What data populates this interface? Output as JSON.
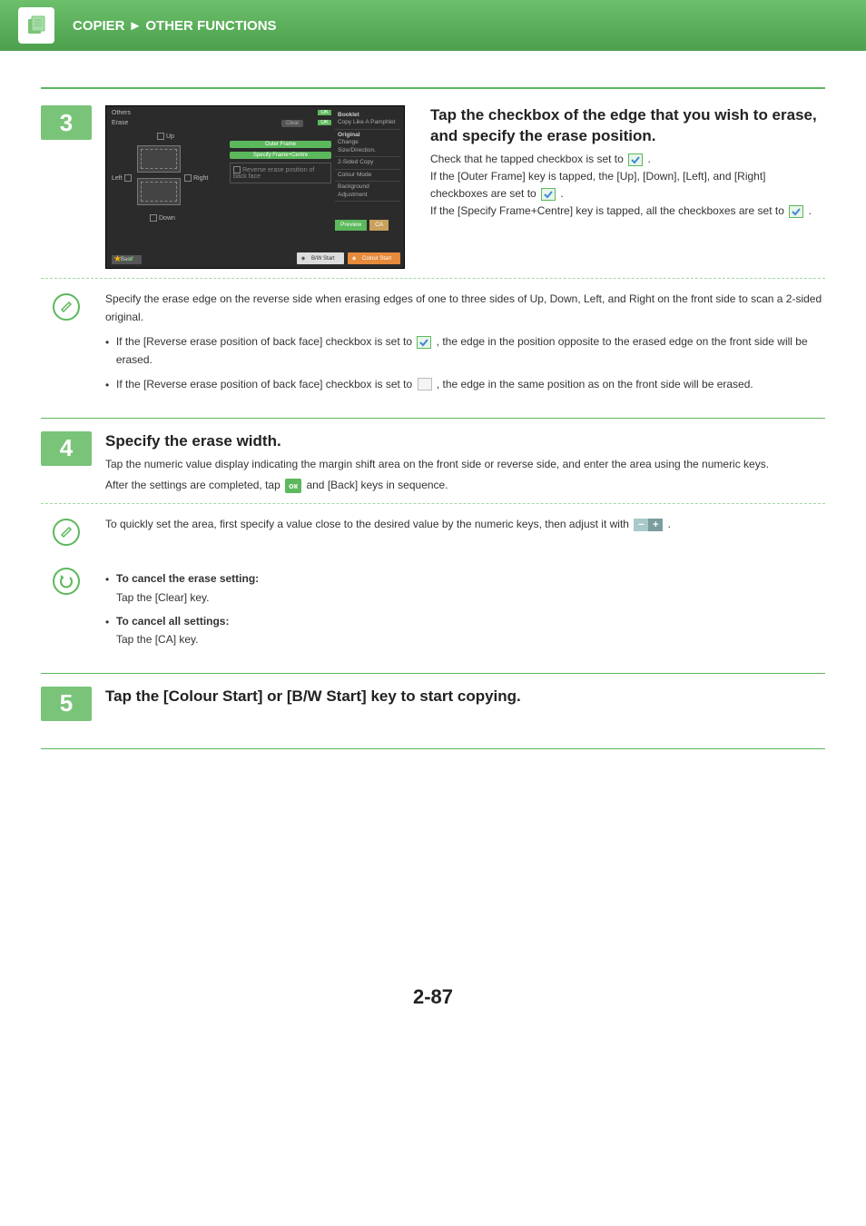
{
  "header": {
    "breadcrumb_left": "COPIER",
    "breadcrumb_sep": "►",
    "breadcrumb_right": "OTHER FUNCTIONS"
  },
  "step3": {
    "num": "3",
    "title": "Tap the checkbox of the edge that you wish to erase, and specify the erase position.",
    "desc_line1a": "Check that he tapped checkbox is set to ",
    "desc_line1b": " .",
    "desc_line2": "If the [Outer Frame] key is tapped, the [Up], [Down], [Left], and [Right] checkboxes are set to ",
    "desc_line2b": " .",
    "desc_line3a": "If the [Specify Frame+Centre] key is tapped, all the checkboxes are set to ",
    "desc_line3b": " .",
    "scr": {
      "others": "Others",
      "ok": "OK",
      "erase": "Erase",
      "clear": "Clear",
      "up": "Up",
      "left": "Left",
      "right": "Right",
      "down": "Down",
      "outer": "Outer Frame",
      "specify": "Specify Frame+Centre",
      "reverse": "Reverse erase position of back face",
      "side_booklet": "Booklet",
      "side_booklet_sub": "Copy Like A Pamphlet",
      "side_original": "Original",
      "side_original_sub": "Change Size/Direction.",
      "side_2sided": "2-Sided Copy",
      "side_colour": "Colour Mode",
      "side_bg": "Background Adjustment",
      "preview": "Preview",
      "ca": "CA",
      "bw": "B/W Start",
      "colour_start": "Colour Start",
      "back": "Back"
    }
  },
  "note3": {
    "intro": "Specify the erase edge on the reverse side when erasing edges of one to three sides of Up, Down, Left, and Right on the front side to scan a 2-sided original.",
    "b1a": "If the [Reverse erase position of back face] checkbox is set to ",
    "b1b": " , the edge in the position opposite to the erased edge on the front side will be erased.",
    "b2a": "If the [Reverse erase position of back face] checkbox is set to ",
    "b2b": " , the edge in the same position as on the front side will be erased."
  },
  "step4": {
    "num": "4",
    "title": "Specify the erase width.",
    "desc": "Tap the numeric value display indicating the margin shift area on the front side or reverse side, and enter the area using the numeric keys.",
    "after_a": "After the settings are completed, tap ",
    "after_ok": "ок",
    "after_b": " and [Back] keys in sequence."
  },
  "note4": {
    "tip_a": "To quickly set the area, first specify a value close to the desired value by the numeric keys, then adjust it with ",
    "tip_b": " ."
  },
  "cancel": {
    "h1": "To cancel the erase setting:",
    "t1": "Tap the [Clear] key.",
    "h2": "To cancel all settings:",
    "t2": "Tap the [CA] key."
  },
  "step5": {
    "num": "5",
    "title": "Tap the [Colour Start] or [B/W Start] key to start copying."
  },
  "page_number": "2-87"
}
